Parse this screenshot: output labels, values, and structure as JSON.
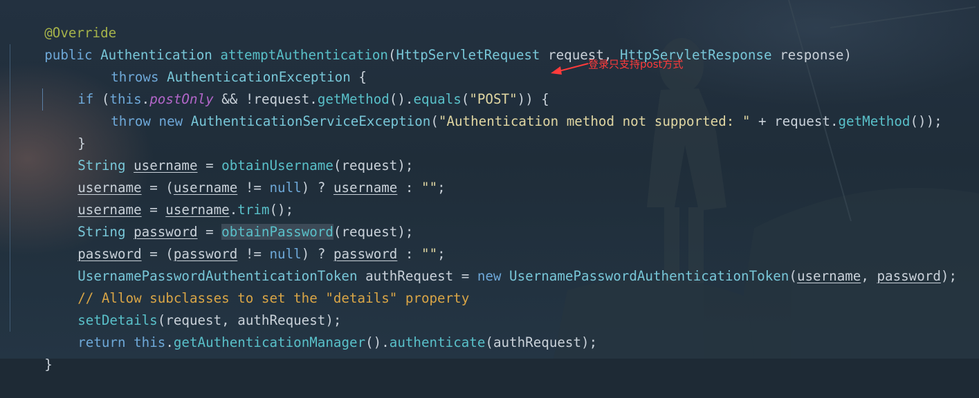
{
  "code": {
    "line1": {
      "annotation": "@Override"
    },
    "line2": {
      "modifier": "public",
      "return_type": "Authentication",
      "method": "attemptAuthentication",
      "open_paren": "(",
      "param1_type": "HttpServletRequest",
      "param1_name": " request, ",
      "param2_type": "HttpServletResponse",
      "param2_name": " response)"
    },
    "line3": {
      "kw": "throws",
      "exception": "AuthenticationException",
      "brace": " {"
    },
    "line4": {
      "kw_if": "if",
      "open": " (",
      "kw_this": "this",
      "dot": ".",
      "field": "postOnly",
      "rest1": " && !request.",
      "method": "getMethod",
      "rest2": "().",
      "equals": "equals",
      "rest3": "(",
      "string": "\"POST\"",
      "rest4": ")) {"
    },
    "line5": {
      "kw_throw": "throw",
      "kw_new": "new",
      "exception": "AuthenticationServiceException",
      "open": "(",
      "string": "\"Authentication method not supported: \"",
      "rest1": " + request.",
      "method": "getMethod",
      "rest2": "());"
    },
    "line6": {
      "brace": "}"
    },
    "line7": {
      "type": "String",
      "var": "username",
      "eq": " = ",
      "call": "obtainUsername",
      "rest": "(request);"
    },
    "line8": {
      "var1": "username",
      "eq": " = (",
      "var2": "username",
      "op": " != ",
      "null": "null",
      "q": ") ? ",
      "var3": "username",
      "colon": " : ",
      "string": "\"\"",
      "end": ";"
    },
    "line9": {
      "var1": "username",
      "eq": " = ",
      "var2": "username",
      "dot": ".",
      "method": "trim",
      "end": "();"
    },
    "line10": {
      "type": "String",
      "var": "password",
      "eq": " = ",
      "call": "obtainPassword",
      "rest": "(request);"
    },
    "line11": {
      "var1": "password",
      "eq": " = (",
      "var2": "password",
      "op": " != ",
      "null": "null",
      "q": ") ? ",
      "var3": "password",
      "colon": " : ",
      "string": "\"\"",
      "end": ";"
    },
    "line12": {
      "type": "UsernamePasswordAuthenticationToken",
      "var": " authRequest = ",
      "kw_new": "new",
      "ctor": "UsernamePasswordAuthenticationToken",
      "open": "(",
      "arg1": "username",
      "comma": ", ",
      "arg2": "password",
      "end": ");"
    },
    "line13": {
      "comment": "// Allow subclasses to set the \"details\" property"
    },
    "line14": {
      "method": "setDetails",
      "rest": "(request, authRequest);"
    },
    "line15": {
      "kw_return": "return",
      "kw_this": "this",
      "dot": ".",
      "method": "getAuthenticationManager",
      "mid": "().",
      "method2": "authenticate",
      "end": "(authRequest);"
    },
    "line16": {
      "brace": "}"
    }
  },
  "annotation_note": "登录只支持post方式",
  "colors": {
    "keyword": "#6ea8d8",
    "function": "#59c0c9",
    "annotation": "#a6b34a",
    "string": "#e0d6a2",
    "comment": "#d9a546",
    "field": "#b266c9",
    "note": "#ff3b3b"
  }
}
